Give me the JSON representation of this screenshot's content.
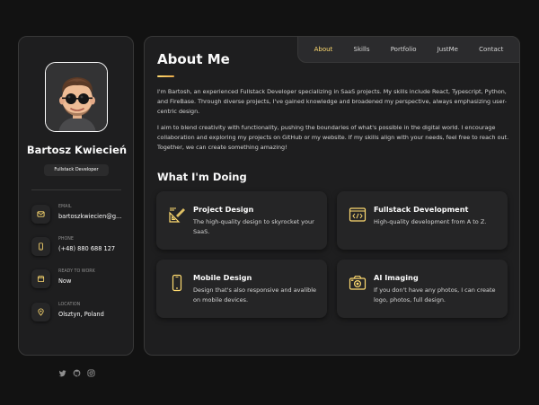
{
  "profile": {
    "name": "Bartosz Kwiecień",
    "title": "Fullstack Developer"
  },
  "contacts": [
    {
      "label": "EMAIL",
      "value": "bartoszkwiecien@g...",
      "icon": "mail-icon"
    },
    {
      "label": "PHONE",
      "value": "(+48) 880 688 127",
      "icon": "phone-icon"
    },
    {
      "label": "READY TO WORK",
      "value": "Now",
      "icon": "calendar-icon"
    },
    {
      "label": "LOCATION",
      "value": "Olsztyn, Poland",
      "icon": "location-icon"
    }
  ],
  "socials": [
    "twitter-icon",
    "github-icon",
    "instagram-icon"
  ],
  "nav": [
    "About",
    "Skills",
    "Portfolio",
    "JustMe",
    "Contact"
  ],
  "active_nav": "About",
  "about": {
    "heading": "About Me",
    "p1": "I'm Bartosh, an experienced Fullstack Developer specializing in SaaS projects. My skills include React, Typescript, Python, and FireBase. Through diverse projects, I've gained knowledge and broadened my perspective, always emphasizing user-centric design.",
    "p2": "I aim to blend creativity with functionality, pushing the boundaries of what's possible in the digital world. I encourage collaboration and exploring my projects on GitHub or my website. If my skills align with your needs, feel free to reach out. Together, we can create something amazing!",
    "services_heading": "What I'm Doing"
  },
  "services": [
    {
      "title": "Project Design",
      "text": "The high-quality design to skyrocket your SaaS.",
      "icon": "design-icon"
    },
    {
      "title": "Fullstack Development",
      "text": "High-quality development from A to Z.",
      "icon": "code-icon"
    },
    {
      "title": "Mobile Design",
      "text": "Design that's also responsive and avalible on mobile devices.",
      "icon": "mobile-icon"
    },
    {
      "title": "AI Imaging",
      "text": "If you don't have any photos, I can create logo, photos, full design.",
      "icon": "camera-icon"
    }
  ],
  "colors": {
    "accent": "#ffdb70",
    "background": "#121212",
    "card": "#1e1e1f"
  }
}
